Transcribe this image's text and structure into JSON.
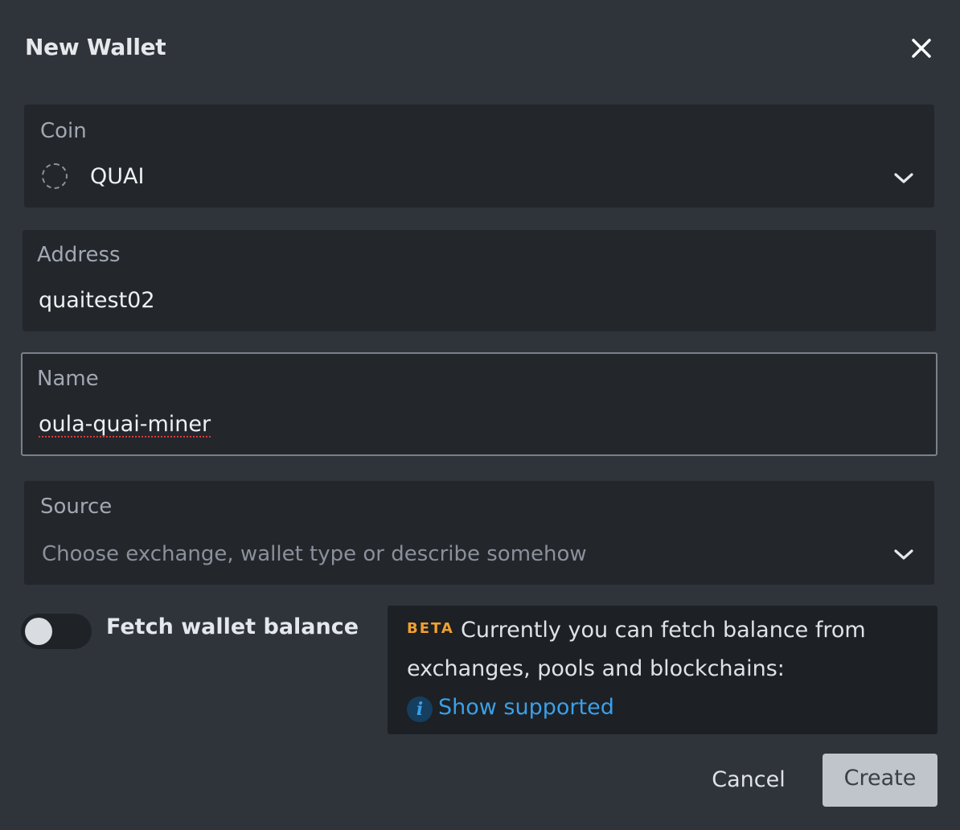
{
  "dialog": {
    "title": "New Wallet",
    "close_icon": "close-icon"
  },
  "coin": {
    "label": "Coin",
    "value": "QUAI",
    "icon": "coin-placeholder-icon",
    "dropdown_icon": "chevron-down-icon"
  },
  "address": {
    "label": "Address",
    "value": "quaitest02"
  },
  "name": {
    "label": "Name",
    "value": "oula-quai-miner"
  },
  "source": {
    "label": "Source",
    "placeholder": "Choose exchange, wallet type or describe somehow",
    "dropdown_icon": "chevron-down-icon"
  },
  "fetch_balance": {
    "label": "Fetch wallet balance",
    "enabled": false
  },
  "info": {
    "badge": "BETA",
    "line1": "Currently you can fetch balance from",
    "line2": "exchanges, pools and blockchains:",
    "link_icon": "info-icon",
    "link_text": "Show supported"
  },
  "actions": {
    "cancel_label": "Cancel",
    "create_label": "Create"
  },
  "colors": {
    "background": "#2f343b",
    "field_background": "#23262b",
    "beta_accent": "#f0a030",
    "link": "#3aa0e8"
  }
}
